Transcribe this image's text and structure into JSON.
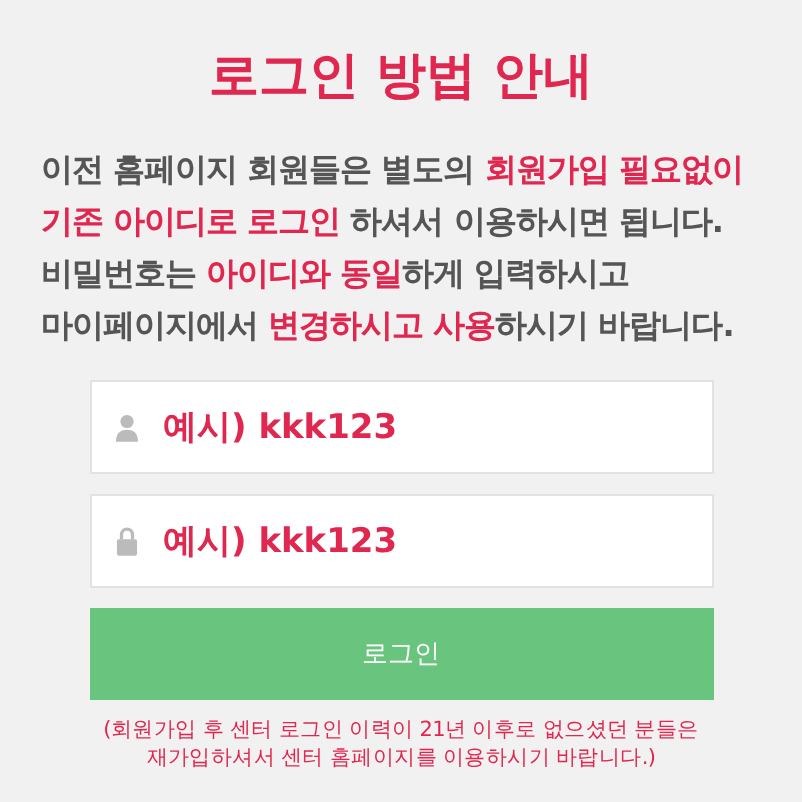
{
  "title": "로그인 방법 안내",
  "guide": [
    "이전 홈페이지 회원들은 별도의 **회원가입 필요없이**",
    "**기존 아이디로 로그인** 하셔서 이용하시면 됩니다.",
    "비밀번호는 **아이디와 동일**하게 입력하시고",
    "마이페이지에서 **변경하시고 사용**하시기 바랍니다."
  ],
  "fields": [
    {
      "kind": "user",
      "placeholder": "예시) kkk123"
    },
    {
      "kind": "password",
      "placeholder": "예시) kkk123"
    }
  ],
  "login_button": "로그인",
  "note": [
    "(회원가입 후 센터 로그인 이력이 21년 이후로 없으셨던 분들은",
    "재가입하셔서 센터 홈페이지를 이용하시기 바랍니다.)"
  ]
}
